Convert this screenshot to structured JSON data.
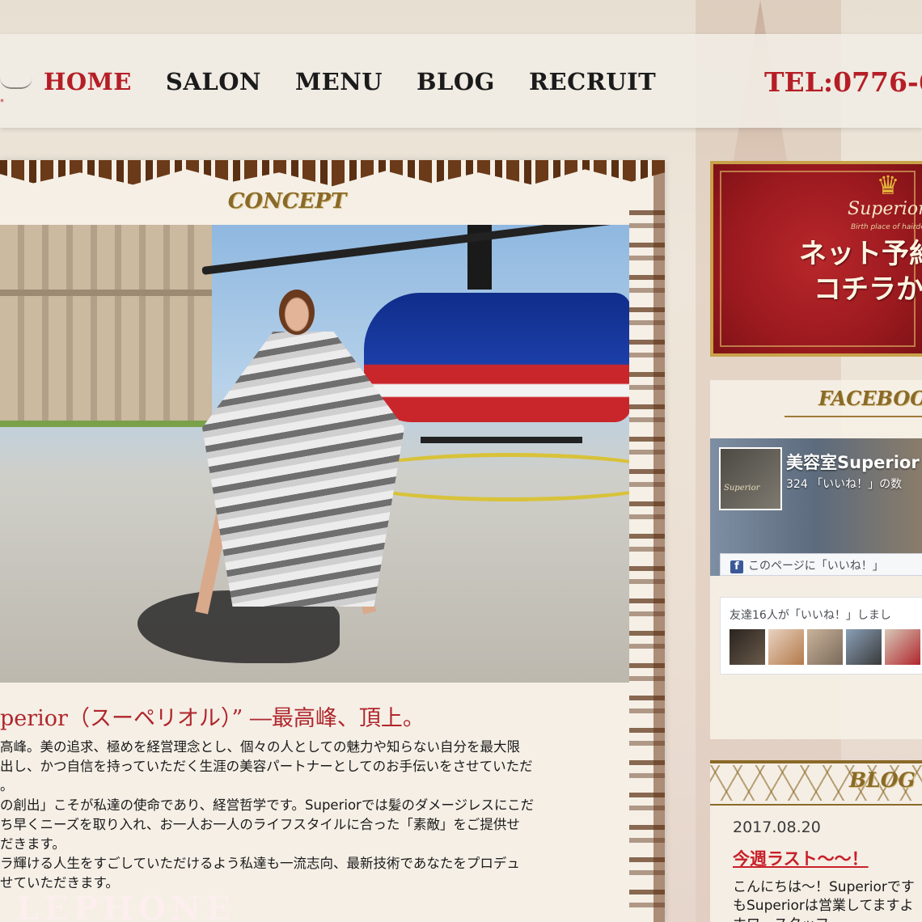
{
  "nav": {
    "items": [
      {
        "label": "HOME",
        "active": true
      },
      {
        "label": "SALON",
        "active": false
      },
      {
        "label": "MENU",
        "active": false
      },
      {
        "label": "BLOG",
        "active": false
      },
      {
        "label": "RECRUIT",
        "active": false
      }
    ],
    "tel": "TEL:0776-6"
  },
  "concept": {
    "title": "CONCEPT",
    "headline": "perior（スーペリオル）” ―最高峰、頂上。",
    "paragraphs": [
      "高峰。美の追求、極めを経営理念とし、個々の人としての魅力や知らない自分を最大限",
      "出し、かつ自信を持っていただく生涯の美容パートナーとしてのお手伝いをさせていただ",
      "。",
      "の創出」こそが私達の使命であり、経営哲学です。Superiorでは髪のダメージレスにこだ",
      "ち早くニーズを取り入れ、お一人お一人のライフスタイルに合った「素敵」をご提供せ",
      "だきます。",
      "ラ輝ける人生をすごしていただけるよう私達も一流志向、最新技術であなたをプロデュ",
      "せていただきます。"
    ],
    "background_text": "LEPHONE"
  },
  "reserve": {
    "brand": "Superior",
    "tagline": "Birth place of hairdesign",
    "line1": "ネット予約",
    "line2": "コチラか"
  },
  "facebook": {
    "title": "FACEBOOK",
    "page_name": "美容室Superior",
    "likes": "324 「いいね！」の数",
    "thumb_brand": "Superior",
    "like_button": "このページに「いいね！」",
    "friends_text": "友達16人が「いいね！」しまし"
  },
  "blog": {
    "title": "BLOG",
    "date": "2017.08.20",
    "post_title": "今週ラスト～～！",
    "excerpt_lines": [
      "こんにちは～！Superiorです",
      "もSuperiorは営業してますよ",
      "ホワ…スタッフ"
    ]
  },
  "colors": {
    "accent_red": "#b51e26",
    "gold": "#8a6a28",
    "banner_red": "#9c1a1f",
    "facebook_blue": "#3b5998"
  }
}
